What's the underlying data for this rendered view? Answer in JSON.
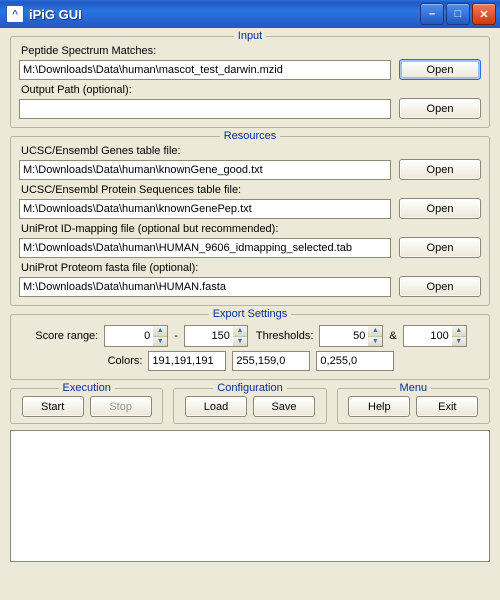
{
  "window": {
    "title": "iPiG GUI",
    "icon_glyph": "^"
  },
  "input": {
    "legend": "Input",
    "psm_label": "Peptide Spectrum Matches:",
    "psm_value": "M:\\Downloads\\Data\\human\\mascot_test_darwin.mzid",
    "psm_open": "Open",
    "out_label": "Output Path (optional):",
    "out_value": "",
    "out_open": "Open"
  },
  "resources": {
    "legend": "Resources",
    "genes_label": "UCSC/Ensembl Genes table file:",
    "genes_value": "M:\\Downloads\\Data\\human\\knownGene_good.txt",
    "genes_open": "Open",
    "prot_label": "UCSC/Ensembl Protein Sequences table file:",
    "prot_value": "M:\\Downloads\\Data\\human\\knownGenePep.txt",
    "prot_open": "Open",
    "idmap_label": "UniProt ID-mapping file  (optional but recommended):",
    "idmap_value": "M:\\Downloads\\Data\\human\\HUMAN_9606_idmapping_selected.tab",
    "idmap_open": "Open",
    "fasta_label": "UniProt Proteom fasta file  (optional):",
    "fasta_value": "M:\\Downloads\\Data\\human\\HUMAN.fasta",
    "fasta_open": "Open"
  },
  "export": {
    "legend": "Export Settings",
    "score_label": "Score range:",
    "score_min": "0",
    "dash": "-",
    "score_max": "150",
    "thr_label": "Thresholds:",
    "thr1": "50",
    "amp": "&",
    "thr2": "100",
    "colors_label": "Colors:",
    "c1": "191,191,191",
    "c2": "255,159,0",
    "c3": "0,255,0"
  },
  "execution": {
    "legend": "Execution",
    "start": "Start",
    "stop": "Stop"
  },
  "configuration": {
    "legend": "Configuration",
    "load": "Load",
    "save": "Save"
  },
  "menu": {
    "legend": "Menu",
    "help": "Help",
    "exit": "Exit"
  },
  "log": ""
}
